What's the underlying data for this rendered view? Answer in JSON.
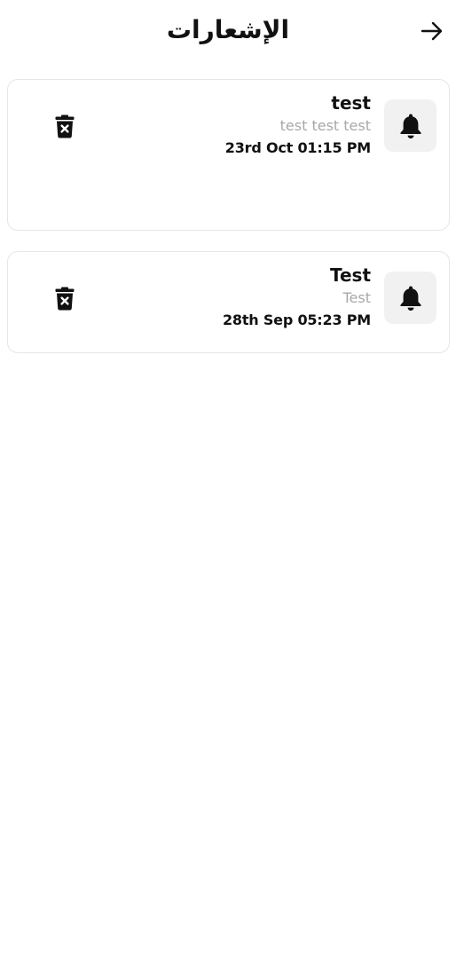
{
  "header": {
    "title": "الإشعارات",
    "back_icon": "arrow-right-icon"
  },
  "notifications": [
    {
      "title": "test",
      "body": "test test test",
      "time": "23rd Oct 01:15 PM",
      "icon": "bell-icon",
      "delete_icon": "trash-x-icon"
    },
    {
      "title": "Test",
      "body": "Test",
      "time": "28th Sep 05:23 PM",
      "icon": "bell-icon",
      "delete_icon": "trash-x-icon"
    }
  ],
  "colors": {
    "background": "#ffffff",
    "card_border": "#e6e6e6",
    "icon_box": "#f1f1f1",
    "text_primary": "#111111",
    "text_secondary": "#a8a8a8"
  }
}
